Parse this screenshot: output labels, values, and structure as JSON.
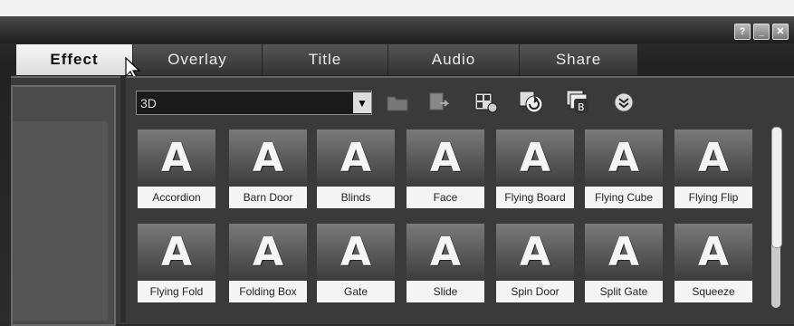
{
  "tabs": [
    {
      "label": "Effect",
      "active": true
    },
    {
      "label": "Overlay",
      "active": false
    },
    {
      "label": "Title",
      "active": false
    },
    {
      "label": "Audio",
      "active": false
    },
    {
      "label": "Share",
      "active": false
    }
  ],
  "window_controls": {
    "help_label": "?",
    "minimize_label": "_",
    "close_label": "✕"
  },
  "category_dropdown": {
    "selected": "3D"
  },
  "toolbar_icons": [
    "folder-icon",
    "export-icon",
    "layout-icon",
    "refresh-icon",
    "gallery-icon",
    "expand-more-icon"
  ],
  "thumbnail_letter": "A",
  "effects": [
    {
      "label": "Accordion"
    },
    {
      "label": "Barn Door"
    },
    {
      "label": "Blinds"
    },
    {
      "label": "Face"
    },
    {
      "label": "Flying Board"
    },
    {
      "label": "Flying Cube"
    },
    {
      "label": "Flying Flip"
    },
    {
      "label": "Flying Fold"
    },
    {
      "label": "Folding Box"
    },
    {
      "label": "Gate"
    },
    {
      "label": "Slide"
    },
    {
      "label": "Spin Door"
    },
    {
      "label": "Split Gate"
    },
    {
      "label": "Squeeze"
    }
  ],
  "colors": {
    "active_tab": "#e8e8e8",
    "background": "#2a2a2a",
    "label_bg": "#f4f4f4"
  }
}
